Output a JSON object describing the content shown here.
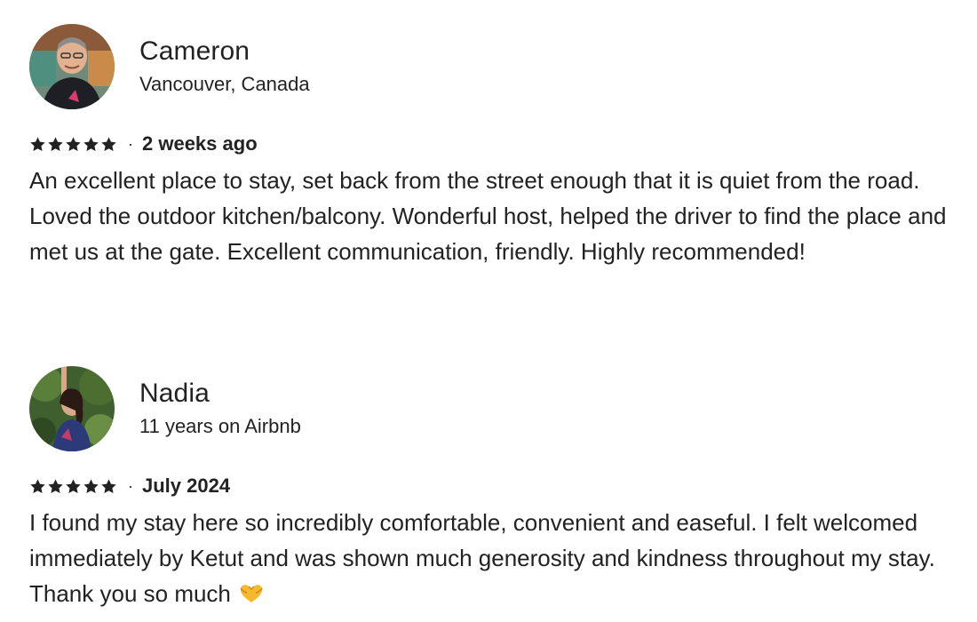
{
  "reviews": [
    {
      "name": "Cameron",
      "meta": "Vancouver, Canada",
      "rating": 5,
      "date": "2 weeks ago",
      "text": "An excellent place to stay, set back from the street enough that it is quiet from the road. Loved the outdoor kitchen/balcony. Wonderful host, helped the driver to find the place and met us at the gate. Excellent communication, friendly. Highly recommended!"
    },
    {
      "name": "Nadia",
      "meta": "11 years on Airbnb",
      "rating": 5,
      "date": "July 2024",
      "text": "I found my stay here so incredibly comfortable, convenient and easeful. I felt welcomed immediately by Ketut and was shown much generosity and kindness throughout my stay. Thank you so much",
      "emoji": "heart-hands-icon"
    }
  ],
  "separator": "·",
  "colors": {
    "text": "#222222",
    "star": "#222222",
    "emoji": "#f5b82e"
  }
}
